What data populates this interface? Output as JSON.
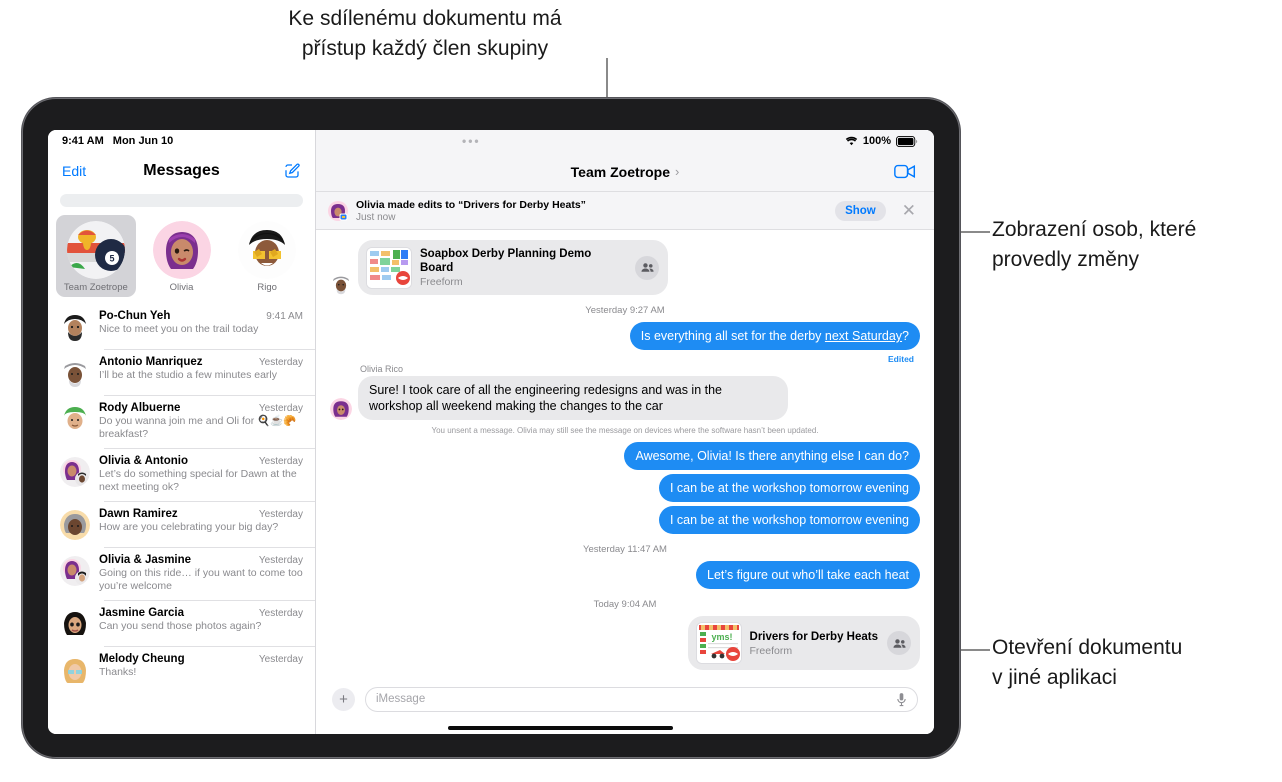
{
  "annotations": {
    "top": "Ke sdílenému dokumentu má\npřístup každý člen skupiny",
    "right_upper": "Zobrazení osob, které\nprovedly změny",
    "right_lower": "Otevření dokumentu\nv jiné aplikaci"
  },
  "accent_color": "#007aff",
  "bubble_out_color": "#1e8cf3",
  "bubble_in_color": "#e9e9eb",
  "sidebar": {
    "status": {
      "time": "9:41 AM",
      "date": "Mon Jun 10"
    },
    "edit_label": "Edit",
    "title": "Messages",
    "compose_icon": "compose-icon",
    "search_placeholder": "",
    "pinned": [
      {
        "name": "Team Zoetrope",
        "selected": true
      },
      {
        "name": "Olivia",
        "selected": false
      },
      {
        "name": "Rigo",
        "selected": false
      }
    ],
    "conversations": [
      {
        "name": "Po-Chun Yeh",
        "time": "9:41 AM",
        "preview": "Nice to meet you on the trail today"
      },
      {
        "name": "Antonio Manriquez",
        "time": "Yesterday",
        "preview": "I’ll be at the studio a few minutes early"
      },
      {
        "name": "Rody Albuerne",
        "time": "Yesterday",
        "preview": "Do you wanna join me and Oli for 🍳☕🥐 breakfast?"
      },
      {
        "name": "Olivia & Antonio",
        "time": "Yesterday",
        "preview": "Let’s do something special for Dawn at the next meeting ok?"
      },
      {
        "name": "Dawn Ramirez",
        "time": "Yesterday",
        "preview": "How are you celebrating your big day?"
      },
      {
        "name": "Olivia & Jasmine",
        "time": "Yesterday",
        "preview": "Going on this ride… if you want to come too you’re welcome"
      },
      {
        "name": "Jasmine Garcia",
        "time": "Yesterday",
        "preview": "Can you send those photos again?"
      },
      {
        "name": "Melody Cheung",
        "time": "Yesterday",
        "preview": "Thanks!"
      }
    ]
  },
  "thread": {
    "status": {
      "wifi": "wifi-icon",
      "battery_pct": "100%"
    },
    "title": "Team Zoetrope",
    "facetime_icon": "facetime-video-icon",
    "banner": {
      "title": "Olivia made edits to “Drivers for Derby Heats”",
      "subtitle": "Just now",
      "show_label": "Show",
      "close_icon": "close-icon"
    },
    "items": [
      {
        "kind": "doccard",
        "side": "in",
        "title": "Soapbox Derby Planning Demo Board",
        "app": "Freeform"
      },
      {
        "kind": "timestamp",
        "text": "Yesterday 9:27 AM"
      },
      {
        "kind": "bubble",
        "side": "out",
        "text": "Is everything all set for the derby next Saturday?",
        "underline": "next Saturday",
        "edited": "Edited"
      },
      {
        "kind": "sender",
        "text": "Olivia Rico"
      },
      {
        "kind": "bubble",
        "side": "in",
        "text": "Sure! I took care of all the engineering redesigns and was in the workshop all weekend making the changes to the car"
      },
      {
        "kind": "notice",
        "text": "You unsent a message. Olivia may still see the message on devices where the software hasn’t been updated."
      },
      {
        "kind": "bubble",
        "side": "out",
        "text": "Awesome, Olivia! Is there anything else I can do?"
      },
      {
        "kind": "bubble",
        "side": "out",
        "text": "I can be at the workshop tomorrow evening"
      },
      {
        "kind": "bubble",
        "side": "out",
        "text": "I can be at the workshop tomorrow evening"
      },
      {
        "kind": "timestamp",
        "text": "Yesterday 11:47 AM"
      },
      {
        "kind": "bubble",
        "side": "out",
        "text": "Let’s figure out who’ll take each heat"
      },
      {
        "kind": "timestamp",
        "text": "Today 9:04 AM"
      },
      {
        "kind": "doccard",
        "side": "out",
        "title": "Drivers for Derby Heats",
        "app": "Freeform"
      }
    ],
    "composer": {
      "plus_icon": "plus-icon",
      "placeholder": "iMessage",
      "mic_icon": "microphone-icon"
    }
  }
}
